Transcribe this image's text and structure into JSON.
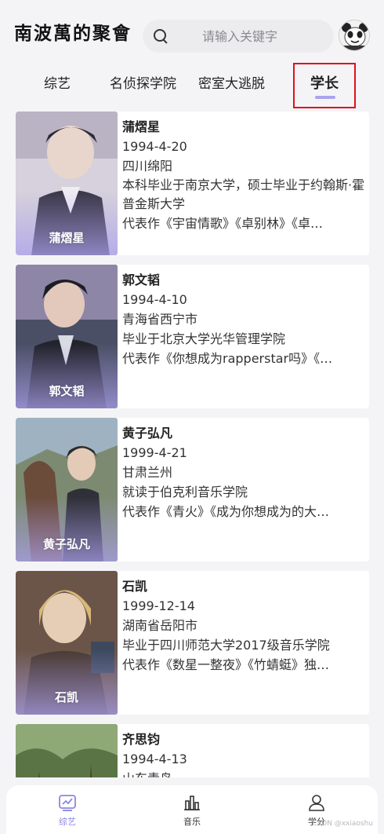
{
  "header": {
    "brand": "南波萬的聚會",
    "search_placeholder": "请输入关键字"
  },
  "tabs": [
    {
      "label": "综艺"
    },
    {
      "label": "名侦探学院"
    },
    {
      "label": "密室大逃脱"
    },
    {
      "label": "学长"
    }
  ],
  "cards": [
    {
      "name": "蒲熠星",
      "birth": "1994-4-20",
      "place": "四川绵阳",
      "edu": "本科毕业于南京大学，硕士毕业于约翰斯·霍普金斯大学",
      "works": "代表作《宇宙情歌》《卓别林》《卓…",
      "photo_colors": [
        "#c9c4d2",
        "#6f6b86"
      ]
    },
    {
      "name": "郭文韬",
      "birth": "1994-4-10",
      "place": "青海省西宁市",
      "edu": "毕业于北京大学光华管理学院",
      "works": "代表作《你想成为rapperstar吗》《…",
      "photo_colors": [
        "#8a8ea6",
        "#2f3244"
      ]
    },
    {
      "name": "黄子弘凡",
      "birth": "1999-4-21",
      "place": "甘肃兰州",
      "edu": "就读于伯克利音乐学院",
      "works": "代表作《青火》《成为你想成为的大…",
      "photo_colors": [
        "#a7b6c2",
        "#6e5e55"
      ]
    },
    {
      "name": "石凯",
      "birth": "1999-12-14",
      "place": "湖南省岳阳市",
      "edu": "毕业于四川师范大学2017级音乐学院",
      "works": "代表作《数星一整夜》《竹蜻蜓》独…",
      "photo_colors": [
        "#b79a7e",
        "#4e3c34"
      ]
    },
    {
      "name": "齐思钧",
      "birth": "1994-4-13",
      "place": "山东青岛",
      "edu": "",
      "works": "",
      "photo_colors": [
        "#6f8a5a",
        "#3f5136"
      ]
    }
  ],
  "bottom_nav": [
    {
      "label": "综艺",
      "icon": "chart-line-icon"
    },
    {
      "label": "音乐",
      "icon": "bar-chart-icon"
    },
    {
      "label": "学分",
      "icon": "user-icon"
    }
  ],
  "watermark": "CSDN @xxiaoshu",
  "colors": {
    "accent": "#a9a4f0",
    "highlight_box": "#e0101c",
    "active_nav": "#8b86e6"
  }
}
